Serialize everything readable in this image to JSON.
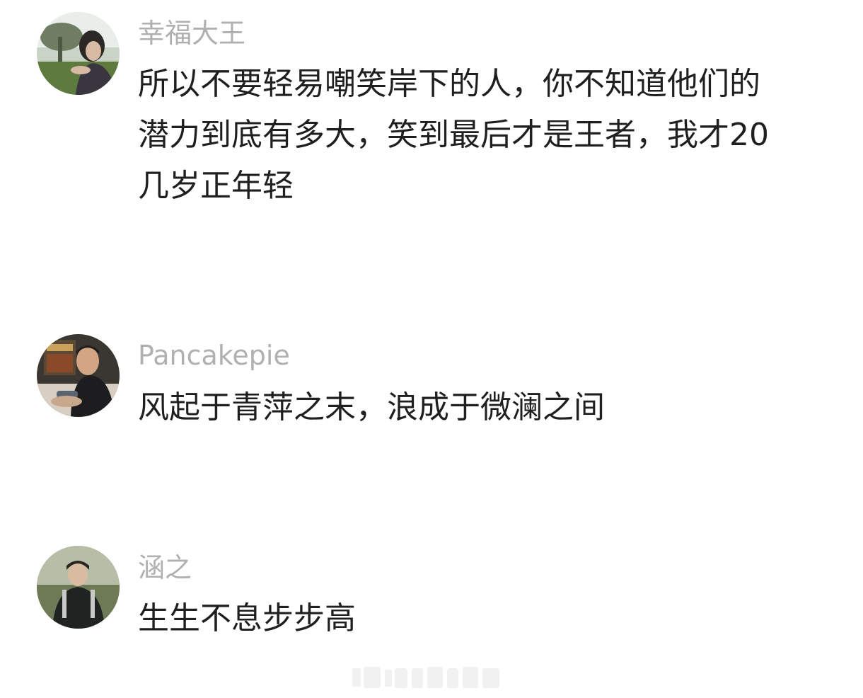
{
  "comments": [
    {
      "username": "幸福大王",
      "text": "所以不要轻易嘲笑岸下的人，你不知道他们的\n潜力到底有多大，笑到最后才是王者，我才20\n几岁正年轻",
      "avatar": "woman-outdoors-avatar"
    },
    {
      "username": "Pancakepie",
      "text": "风起于青萍之末，浪成于微澜之间",
      "avatar": "man-gaming-avatar"
    },
    {
      "username": "涵之",
      "text": "生生不息步步高",
      "avatar": "young-man-jacket-avatar"
    }
  ],
  "colors": {
    "background": "#ffffff",
    "username": "#b0b0b0",
    "text": "#1f1f1f"
  }
}
